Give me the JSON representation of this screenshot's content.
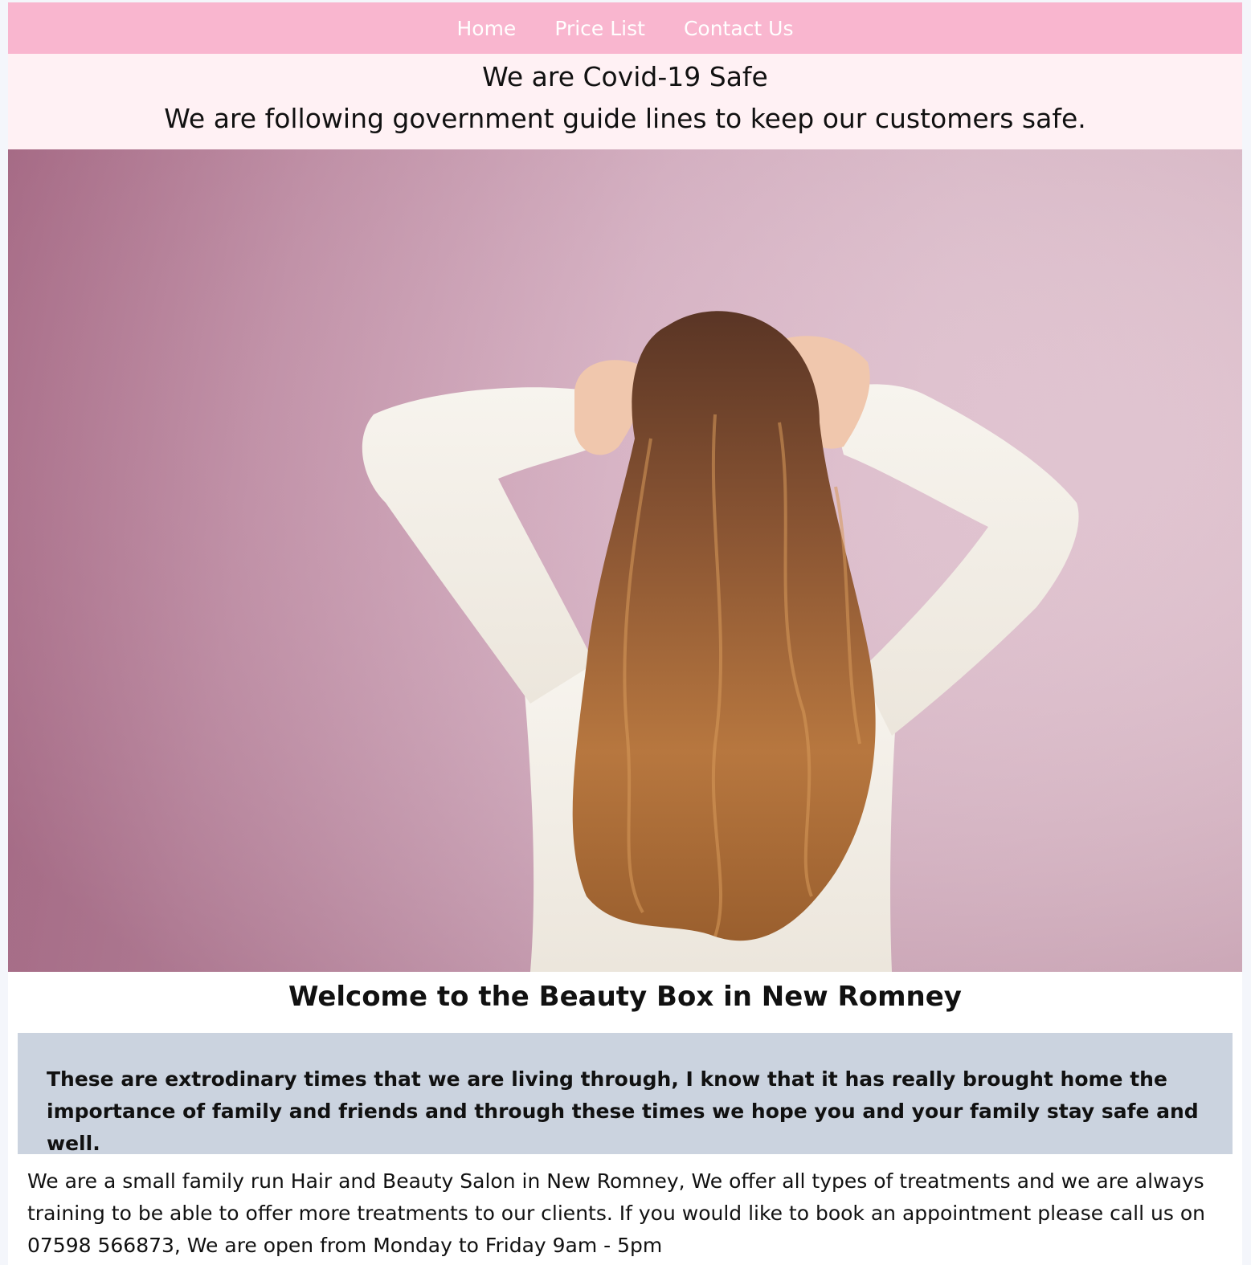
{
  "nav": {
    "items": [
      {
        "label": "Home"
      },
      {
        "label": "Price List"
      },
      {
        "label": "Contact Us"
      }
    ]
  },
  "covid": {
    "title": "We are Covid-19 Safe",
    "subtitle": "We are following government guide lines to keep our customers safe."
  },
  "hero": {
    "image": "woman-with-long-wavy-hair-pink-wall"
  },
  "welcome": {
    "heading": "Welcome to the Beauty Box in New Romney"
  },
  "quote": {
    "text": "These are extrodinary times that we are living through, I know that it has really brought home the importance of family and friends and through these times we hope you and your family stay safe and well."
  },
  "about": {
    "text": "We are a small family run Hair and Beauty Salon in New Romney, We offer all types of treatments and we are always training to be able to offer more treatments to our clients. If you would like to book an appointment please call us on 07598 566873, We are open from Monday to Friday 9am - 5pm"
  },
  "colors": {
    "nav_bg": "#f9b6cf",
    "banner_bg": "#fff1f4",
    "quote_bg": "#cbd3df"
  }
}
